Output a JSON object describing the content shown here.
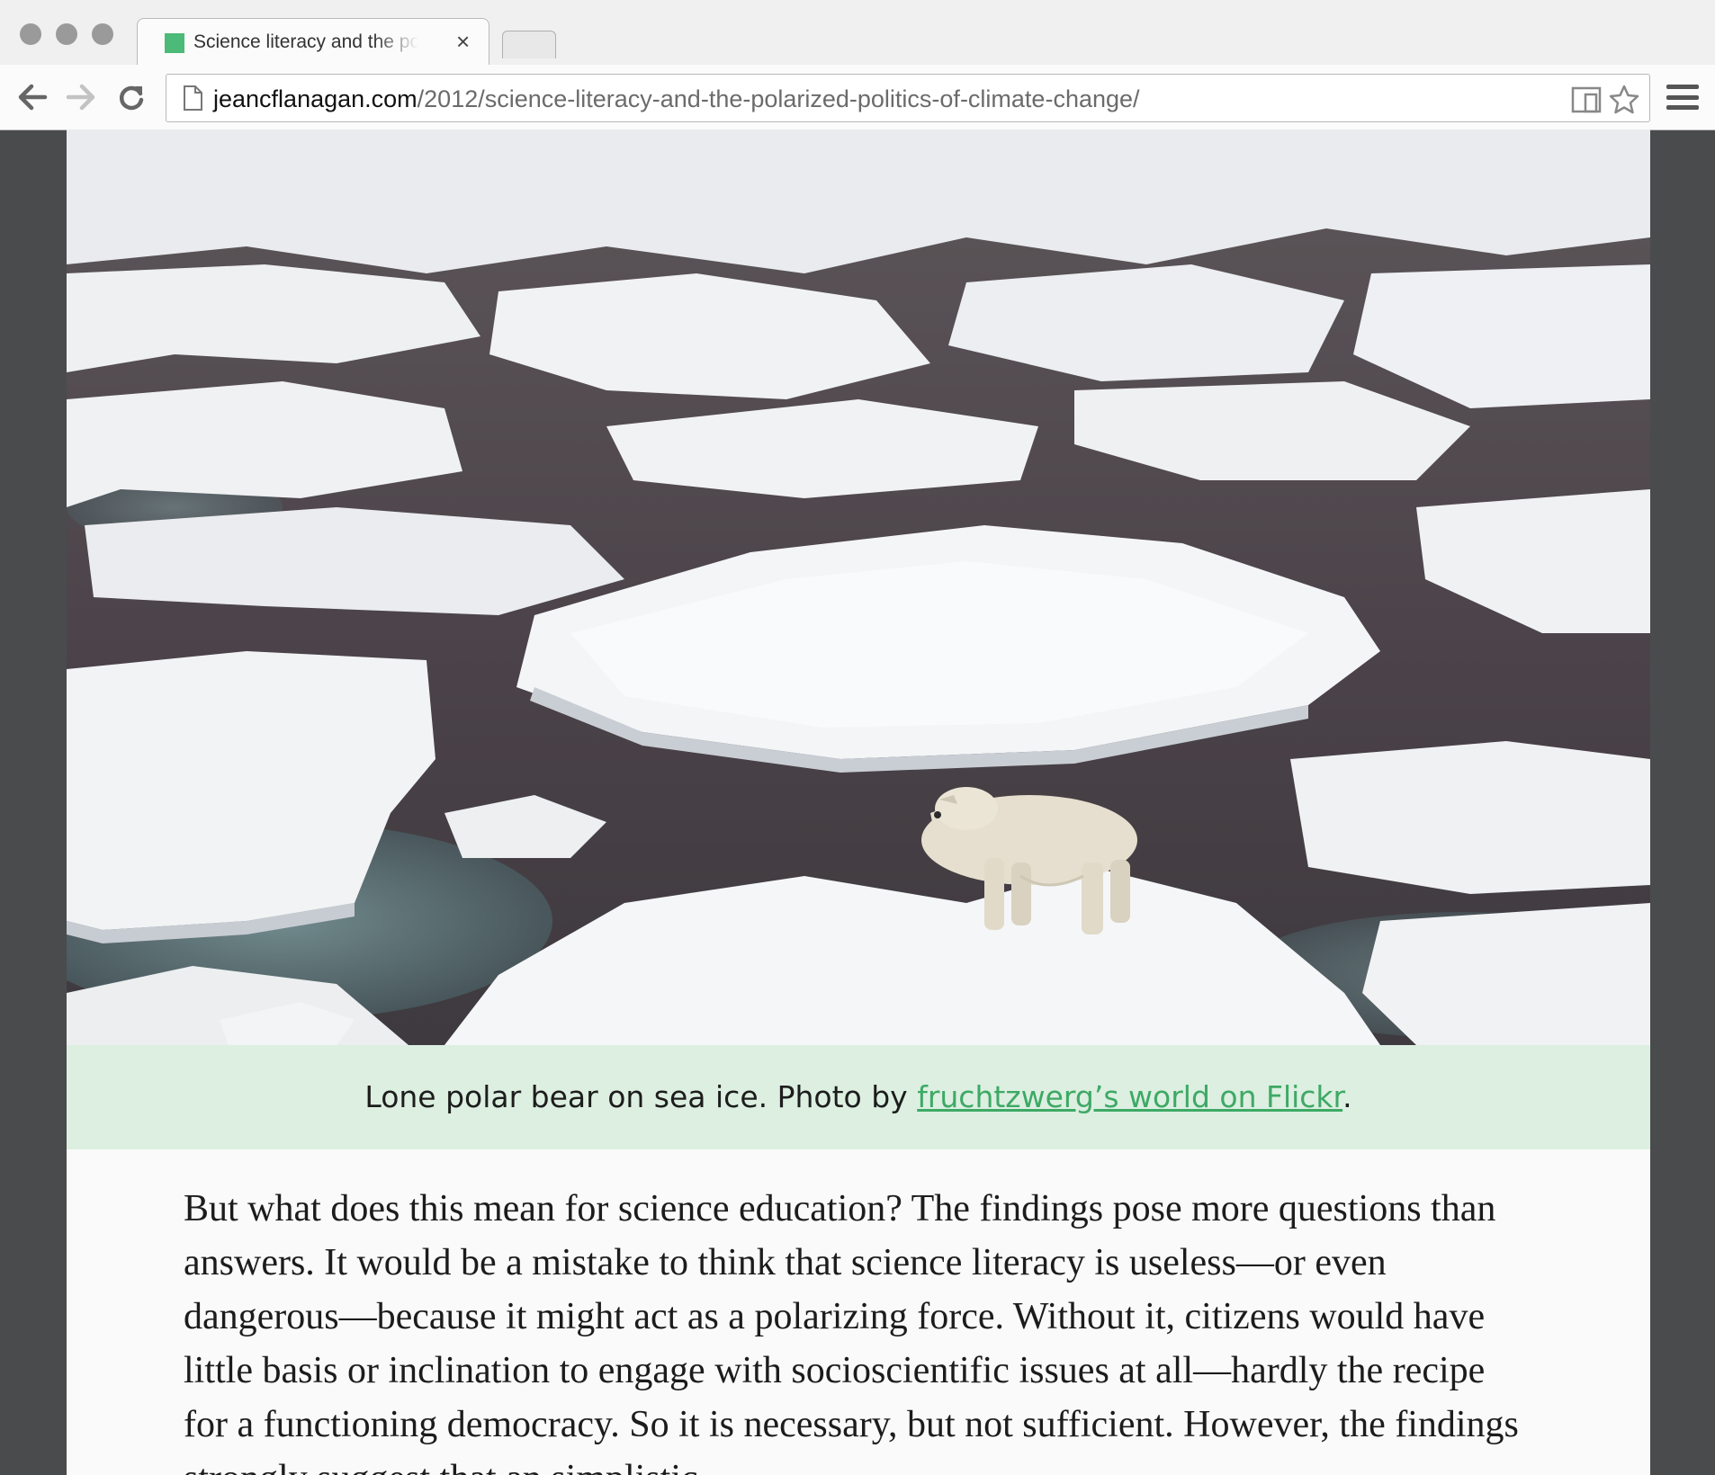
{
  "browser": {
    "tab_title": "Science literacy and the polarized politics of climate change",
    "tab_close": "×",
    "url_host": "jeancflanagan.com",
    "url_path": "/2012/science-literacy-and-the-polarized-politics-of-climate-change/",
    "favicon_color": "#4cba78"
  },
  "figure": {
    "image_subject": "polar bear standing on sea ice floes in dark water",
    "caption_text": "Lone polar bear on sea ice. Photo by ",
    "caption_link": "fruchtzwerg’s world on Flickr",
    "caption_end": ".",
    "caption_bg": "#dcefe1",
    "link_color": "#3ea965"
  },
  "article": {
    "paragraph": "But what does this mean for science education? The findings pose more questions than answers. It would be a mistake to think that science literacy is useless—or even dangerous—because it might act as a polarizing force. Without it, citizens would have little basis or inclination to engage with socioscientific issues at all—hardly the recipe for a functioning democracy. So it is necessary, but not sufficient. However, the findings strongly suggest that an simplistic"
  }
}
